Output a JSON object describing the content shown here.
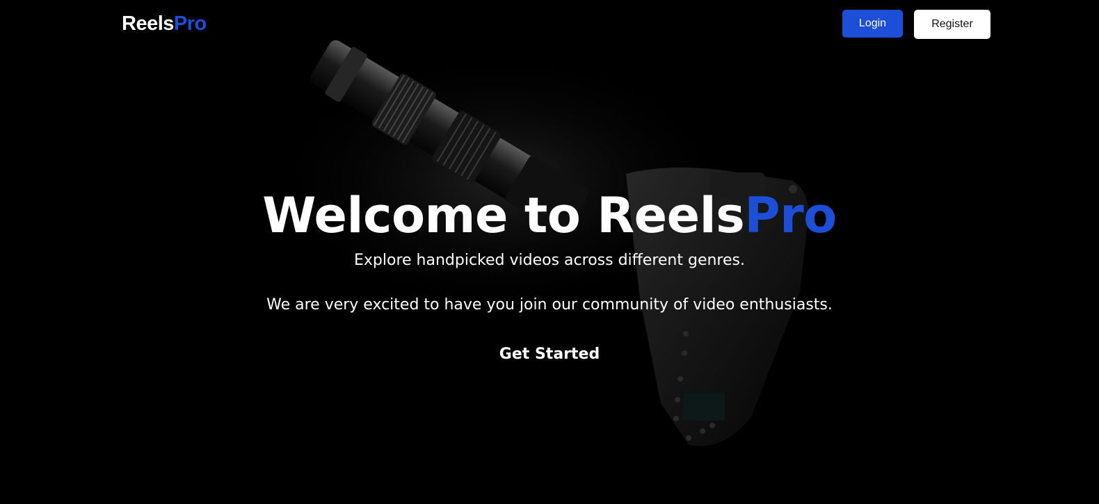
{
  "nav": {
    "logo_primary": "Reels",
    "logo_accent": "Pro",
    "login_label": "Login",
    "register_label": "Register"
  },
  "hero": {
    "title_prefix": "Welcome to Reels",
    "title_accent": "Pro",
    "subtitle": "Explore handpicked videos across different genres.",
    "tagline": "We are very excited to have you join our community of video enthusiasts.",
    "cta_label": "Get Started"
  },
  "colors": {
    "background": "#000000",
    "accent": "#1d4ed8",
    "text": "#ffffff"
  },
  "background_image": "camera-with-telephoto-lens"
}
